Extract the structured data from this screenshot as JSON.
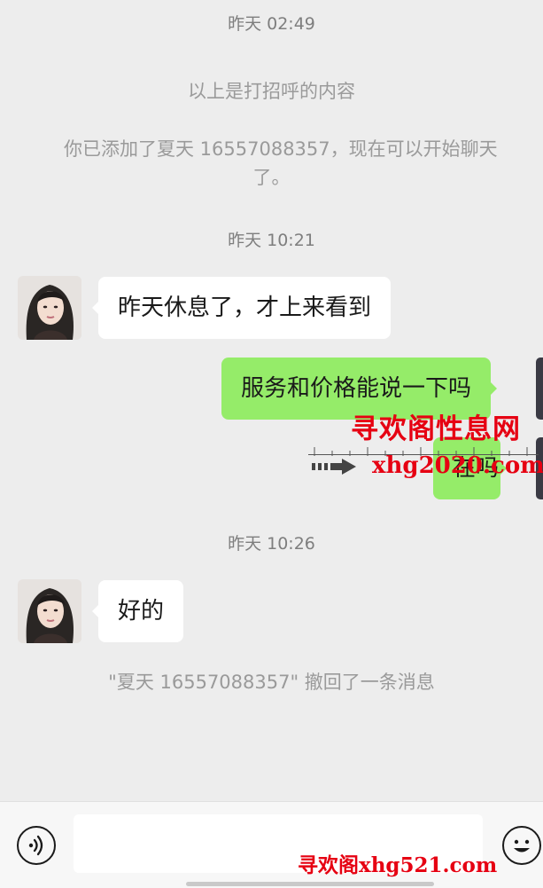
{
  "chat": {
    "timestamp_1": "昨天 02:49",
    "system_greeting_note": "以上是打招呼的内容",
    "system_added_line1": "你已添加了夏天 16557088357，现在可以开始聊天",
    "system_added_line2": "了。",
    "timestamp_2": "昨天 10:21",
    "msg_in_1": "昨天休息了，才上来看到",
    "msg_out_1": "服务和价格能说一下吗",
    "msg_out_2_partial": "在吗",
    "timestamp_3": "昨天 10:26",
    "msg_in_2": "好的",
    "system_recalled": "\"夏天 16557088357\" 撤回了一条消息"
  },
  "watermarks": {
    "center_cn": "寻欢阁性息网",
    "center_url": "xhg2020.com",
    "bottom": "寻欢阁xhg521.com"
  },
  "input": {
    "value": ""
  },
  "icons": {
    "voice": "voice-icon",
    "emoji": "emoji-icon",
    "avatar": "avatar-icon",
    "arrow": "arrow-right-icon"
  },
  "colors": {
    "background": "#ededed",
    "bubble_in": "#ffffff",
    "bubble_out": "#95ec69",
    "watermark_red": "#e60012"
  }
}
